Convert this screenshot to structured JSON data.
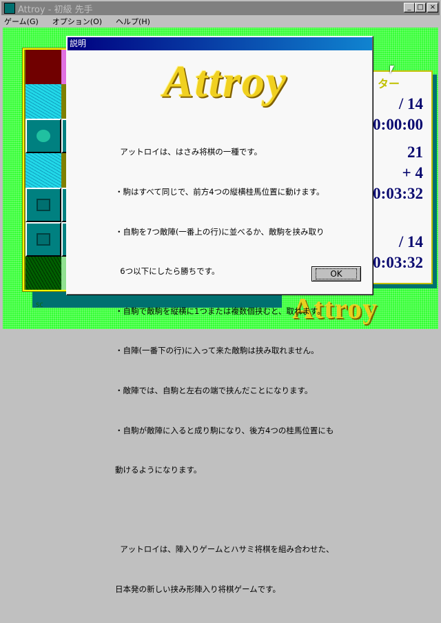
{
  "window": {
    "title": "Attroy - 初級  先手",
    "buttons": {
      "minimize": "_",
      "maximize": "□",
      "close": "×"
    }
  },
  "menu": [
    "ゲーム(G)",
    "オプション(O)",
    "ヘルプ(H)"
  ],
  "board": {
    "footer_text": "SC"
  },
  "panel": {
    "title": "ター",
    "rows": [
      "/ 14",
      "0:00:00",
      "21",
      "+ 4",
      "0:03:32",
      "/ 14",
      "0:03:32"
    ]
  },
  "background_logo": "Attroy",
  "dialog": {
    "title": "説明",
    "logo": "Attroy",
    "lines": [
      "  アットロイは、はさみ将棋の一種です。",
      "・駒はすべて同じで、前方4つの縦横桂馬位置に動けます。",
      "・自駒を7つ敵陣(一番上の行)に並べるか、敵駒を挟み取り",
      "  6つ以下にしたら勝ちです。",
      "・自駒で敵駒を縦横に1つまたは複数個挟むと、取れます。",
      "・自陣(一番下の行)に入って来た敵駒は挟み取れません。",
      "・敵陣では、自駒と左右の端で挟んだことになります。",
      "・自駒が敵陣に入ると成り駒になり、後方4つの桂馬位置にも",
      "動けるようになります。",
      "",
      "  アットロイは、陣入りゲームとハサミ将棋を組み合わせた、",
      "日本発の新しい挟み形陣入り将棋ゲームです。"
    ],
    "ok": "OK"
  }
}
